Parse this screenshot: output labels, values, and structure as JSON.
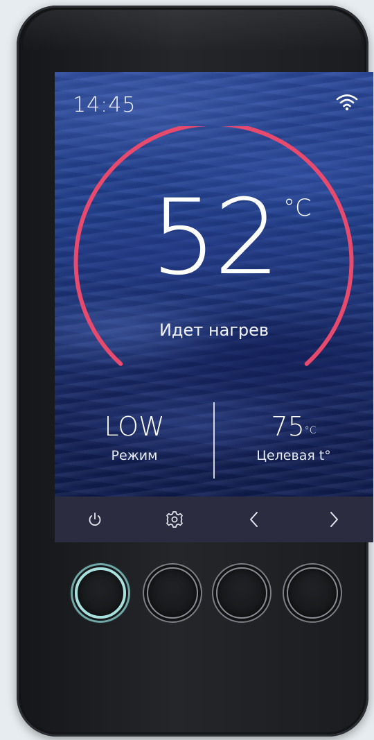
{
  "status_bar": {
    "time": "14:45",
    "wifi_icon": "wifi-icon"
  },
  "dial": {
    "temperature": "52",
    "unit": "°C",
    "status": "Идет нагрев",
    "arc_color": "#e84a6e"
  },
  "mode": {
    "value": "LOW",
    "label": "Режим"
  },
  "target": {
    "value": "75",
    "unit": "°C",
    "label": "Целевая t°"
  },
  "navbar": {
    "items": [
      {
        "icon": "power-icon"
      },
      {
        "icon": "gear-icon"
      },
      {
        "icon": "chevron-left-icon"
      },
      {
        "icon": "chevron-right-icon"
      }
    ]
  },
  "hardware_buttons": {
    "count": 4,
    "active_index": 0,
    "active_color": "#a7e0dc"
  }
}
